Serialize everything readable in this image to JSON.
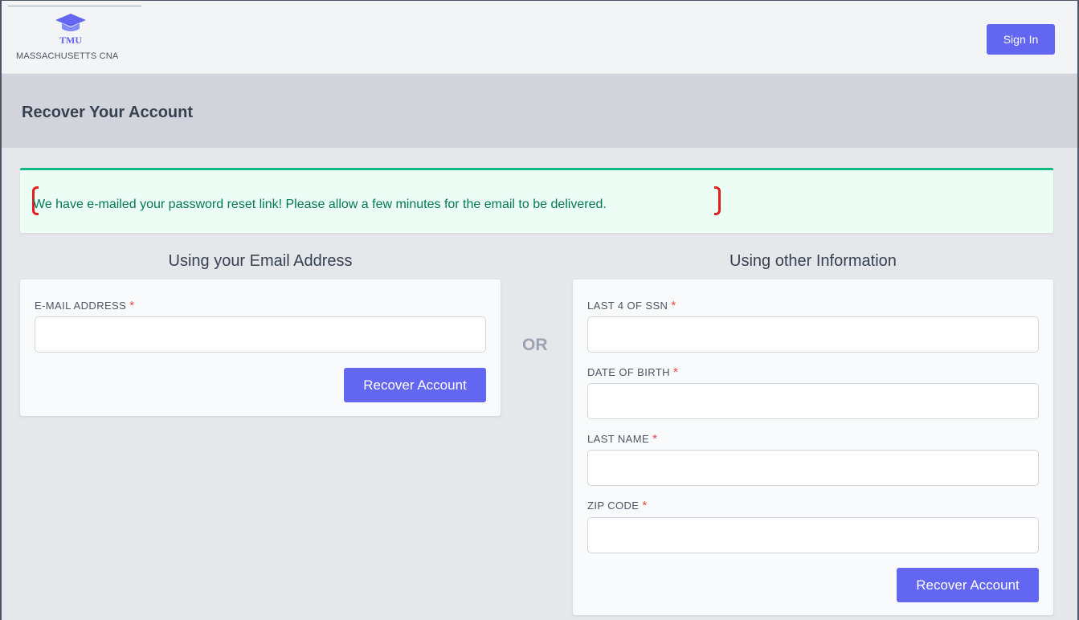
{
  "header": {
    "logo_abbr": "TMU",
    "logo_state": "MASSACHUSETTS CNA",
    "signin_label": "Sign In"
  },
  "page": {
    "title": "Recover Your Account"
  },
  "alert": {
    "message": "We have e-mailed your password reset link! Please allow a few minutes for the email to be delivered."
  },
  "email_section": {
    "title": "Using your Email Address",
    "email_label": "E-MAIL ADDRESS",
    "email_value": "",
    "required_mark": "*",
    "button_label": "Recover Account"
  },
  "divider": {
    "label": "OR"
  },
  "other_section": {
    "title": "Using other Information",
    "required_mark": "*",
    "fields": [
      {
        "label": "LAST 4 OF SSN",
        "value": ""
      },
      {
        "label": "DATE OF BIRTH",
        "value": ""
      },
      {
        "label": "LAST NAME",
        "value": ""
      },
      {
        "label": "ZIP CODE",
        "value": ""
      }
    ],
    "button_label": "Recover Account"
  },
  "colors": {
    "accent": "#6366f1",
    "success_text": "#047857",
    "success_bg": "#ecfdf5",
    "success_border": "#10b981",
    "required": "#ef4444",
    "annotation": "#e11d1d"
  },
  "icons": {
    "logo": "graduation-cap-icon"
  }
}
